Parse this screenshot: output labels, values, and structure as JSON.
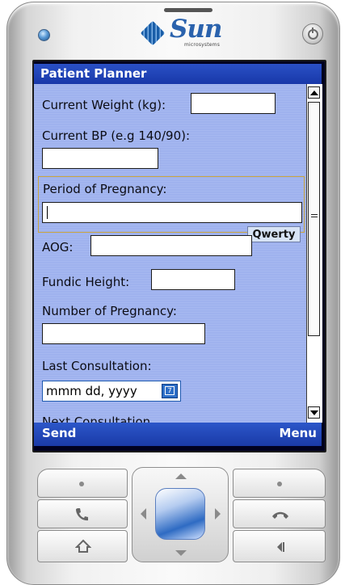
{
  "device": {
    "brand_logo_text": "Sun",
    "brand_logo_subtext": "microsystems"
  },
  "app": {
    "title": "Patient Planner"
  },
  "form": {
    "current_weight_label": "Current Weight (kg):",
    "current_weight_value": "",
    "current_bp_label": "Current BP (e.g 140/90):",
    "current_bp_value": "",
    "pregnancy_period_label": "Period of Pregnancy:",
    "pregnancy_period_value": "",
    "input_mode": "Qwerty",
    "aog_label": "AOG:",
    "aog_value": "",
    "fundic_height_label": "Fundic Height:",
    "fundic_height_value": "",
    "pregnancy_count_label": "Number of Pregnancy:",
    "pregnancy_count_value": "",
    "last_consultation_label": "Last Consultation:",
    "last_consultation_value": "mmm dd, yyyy",
    "calendar_button_glyph": "7",
    "next_consultation_label": "Next Consultation"
  },
  "softkeys": {
    "left": "Send",
    "right": "Menu"
  },
  "colors": {
    "title_bar": "#1e40b4",
    "form_background": "#a3b6ef",
    "focus_border": "#caa53e"
  },
  "icons": [
    "power-icon",
    "call-icon",
    "end-call-icon",
    "home-icon",
    "back-icon"
  ]
}
